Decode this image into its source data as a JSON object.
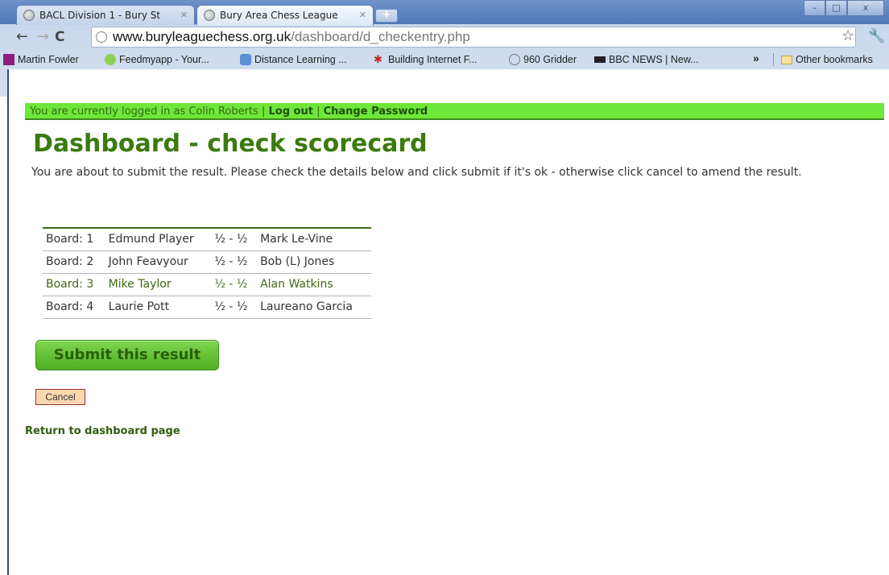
{
  "browser": {
    "tabs": [
      {
        "label": "BACL Division 1 - Bury St"
      },
      {
        "label": "Bury Area Chess League"
      }
    ],
    "new_tab": "+",
    "window_controls": {
      "minimize": "–",
      "maximize": "□",
      "close": "x"
    },
    "url_host": "www.buryleaguechess.org.uk",
    "url_path": "/dashboard/d_checkentry.php",
    "bookmarks": [
      {
        "label": "Martin Fowler",
        "icon": "martin-fowler-icon"
      },
      {
        "label": "Feedmyapp - Your...",
        "icon": "feedmyapp-icon"
      },
      {
        "label": "Distance Learning ...",
        "icon": "distance-learning-icon"
      },
      {
        "label": "Building Internet F...",
        "icon": "building-internet-icon"
      },
      {
        "label": "960 Gridder",
        "icon": "globe-icon"
      },
      {
        "label": "BBC NEWS | New...",
        "icon": "bbc-icon"
      }
    ],
    "overflow": "»",
    "other_bookmarks": "Other bookmarks"
  },
  "login": {
    "text": "You are currently logged in as Colin Roberts |",
    "logout": "Log out",
    "separator": "|",
    "change_password": "Change Password"
  },
  "page": {
    "title": "Dashboard - check scorecard",
    "intro": "You are about to submit the result. Please check the details below and click submit if it's ok - otherwise click cancel to amend the result."
  },
  "boards": [
    {
      "board": "Board: 1",
      "home": "Edmund Player",
      "score": "½ - ½",
      "away": "Mark Le-Vine"
    },
    {
      "board": "Board: 2",
      "home": "John Feavyour",
      "score": "½ - ½",
      "away": "Bob (L) Jones"
    },
    {
      "board": "Board: 3",
      "home": "Mike Taylor",
      "score": "½ - ½",
      "away": "Alan Watkins"
    },
    {
      "board": "Board: 4",
      "home": "Laurie Pott",
      "score": "½ - ½",
      "away": "Laureano Garcia"
    }
  ],
  "actions": {
    "submit": "Submit this result",
    "cancel": "Cancel",
    "return": "Return to dashboard page"
  }
}
